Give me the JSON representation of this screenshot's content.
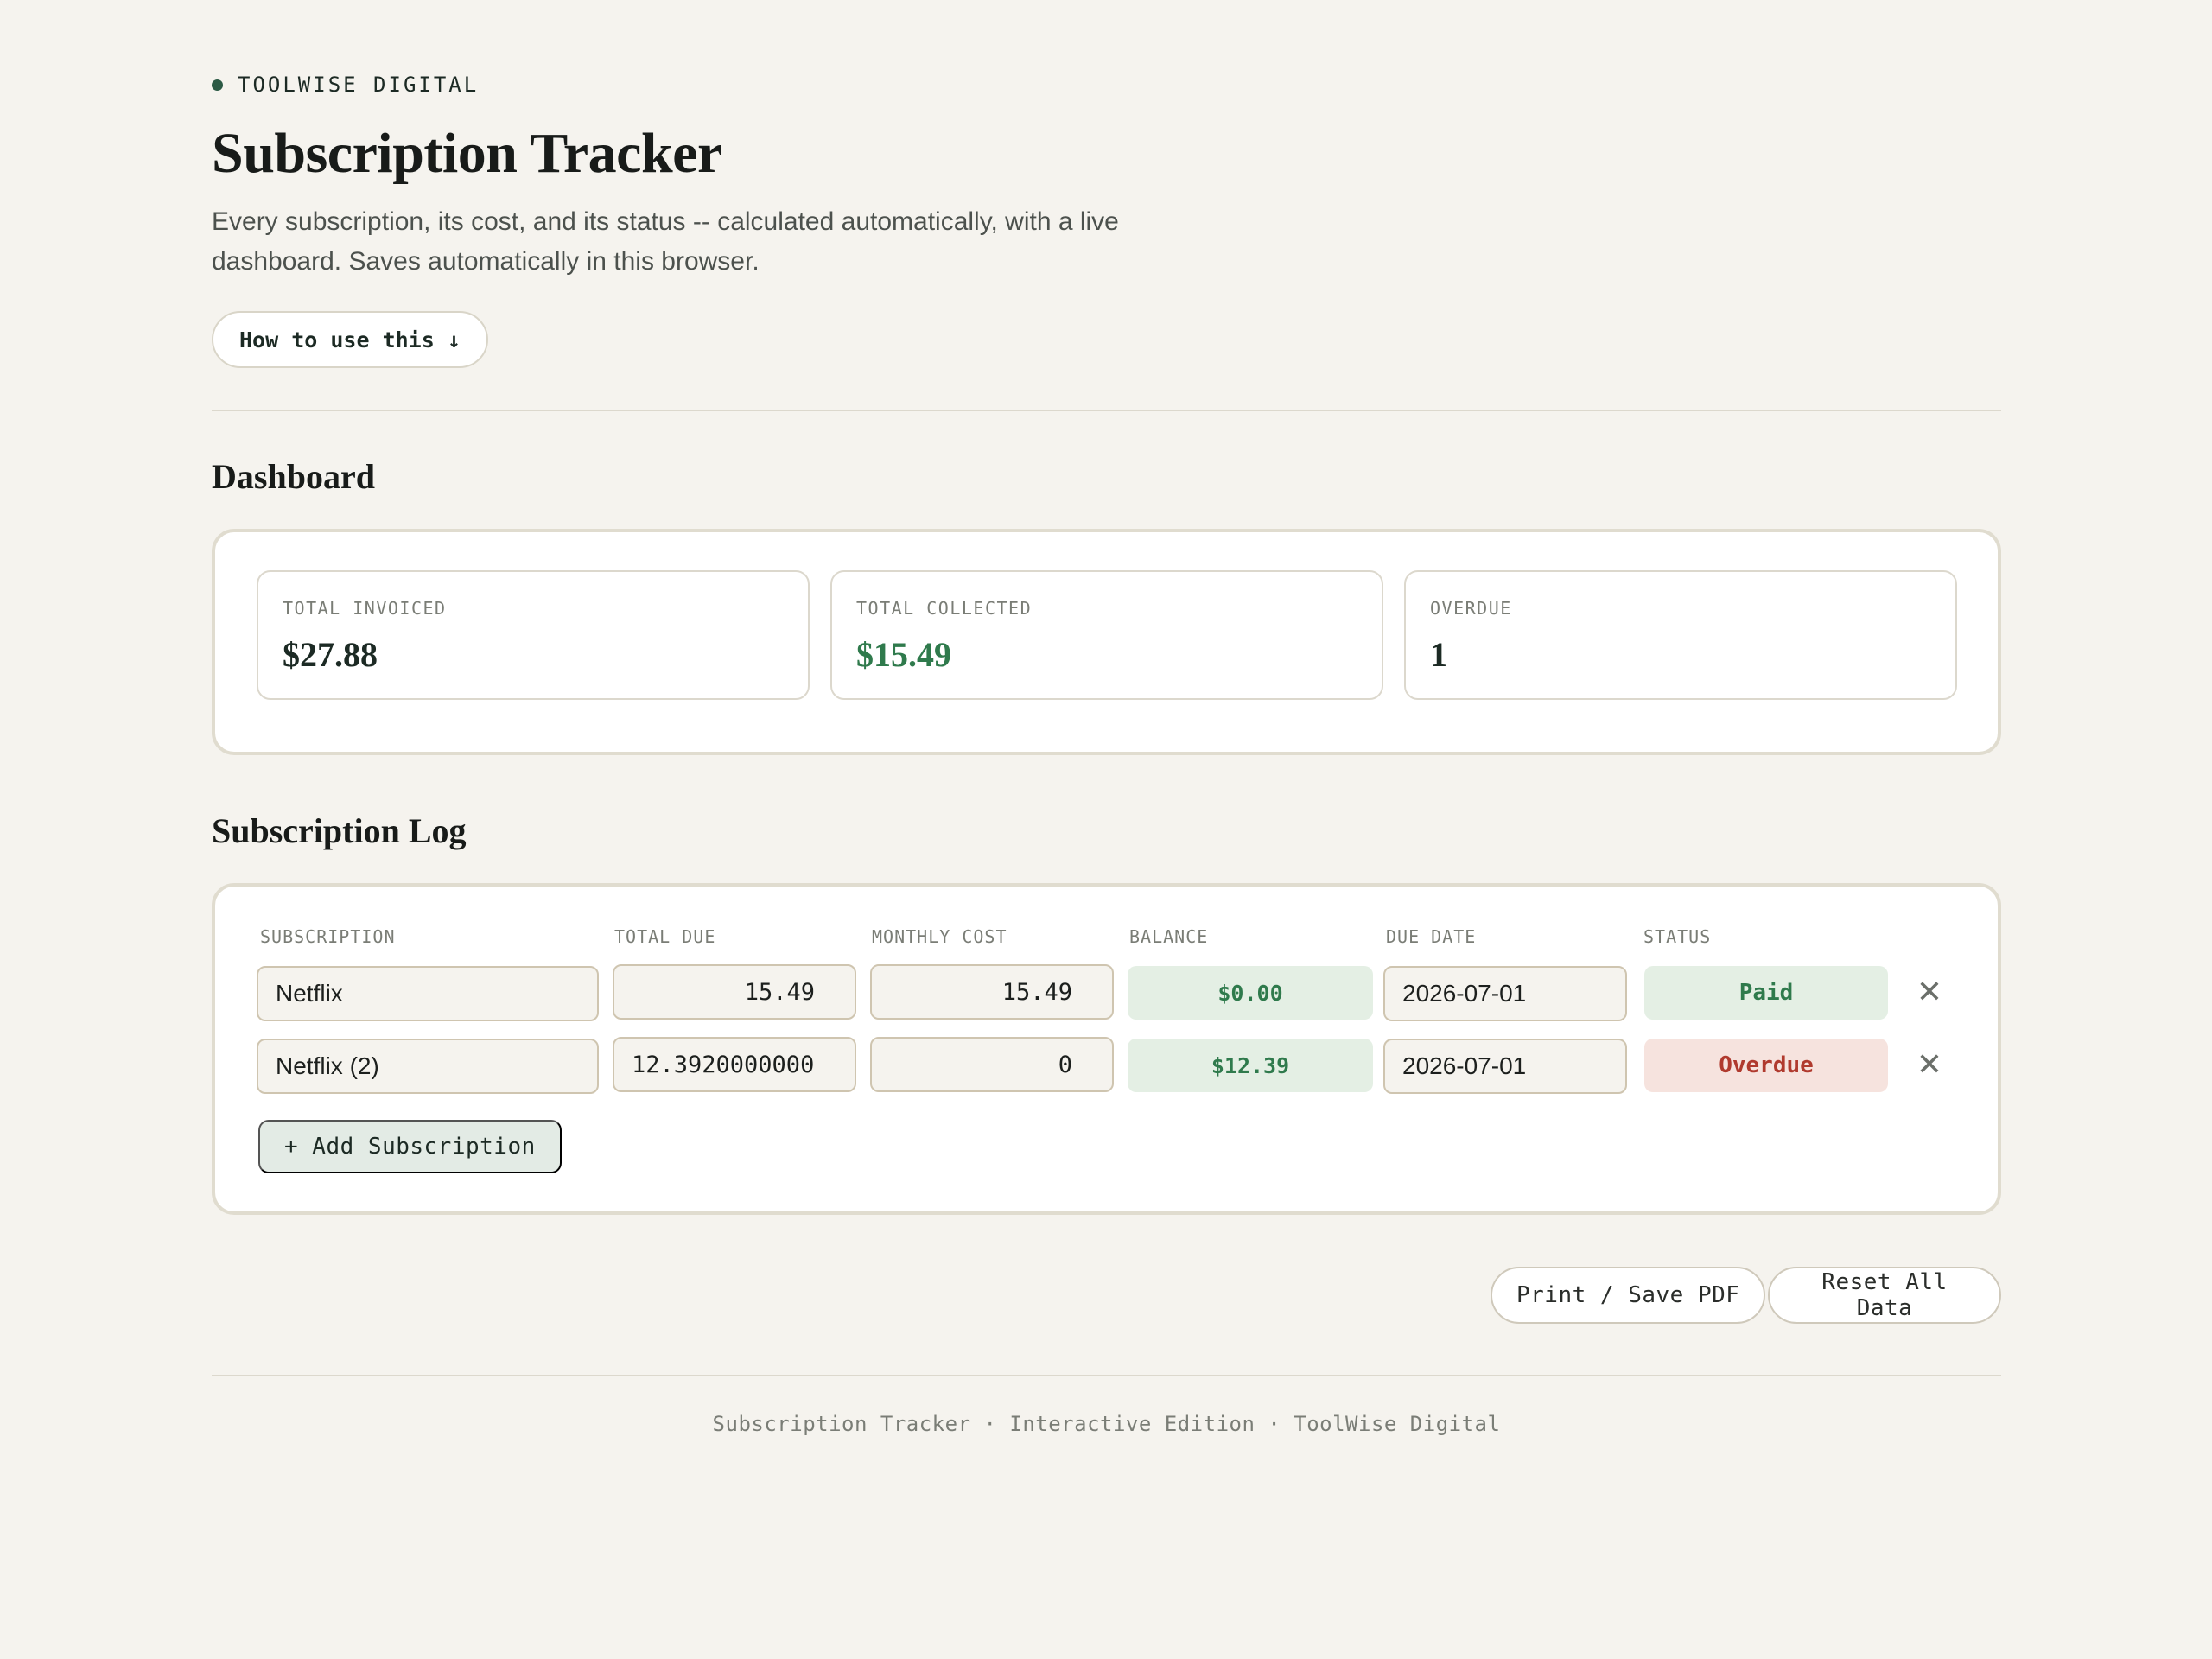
{
  "brand": {
    "name": "TOOLWISE DIGITAL"
  },
  "header": {
    "title": "Subscription Tracker",
    "description": "Every subscription, its cost, and its status -- calculated automatically, with a live dashboard. Saves automatically in this browser.",
    "howto_label": "How to use this ↓"
  },
  "dashboard": {
    "heading": "Dashboard",
    "stats": [
      {
        "label": "TOTAL INVOICED",
        "value": "$27.88"
      },
      {
        "label": "TOTAL COLLECTED",
        "value": "$15.49"
      },
      {
        "label": "OVERDUE",
        "value": "1"
      }
    ]
  },
  "log": {
    "heading": "Subscription Log",
    "columns": [
      "SUBSCRIPTION",
      "TOTAL DUE",
      "MONTHLY COST",
      "BALANCE",
      "DUE DATE",
      "STATUS"
    ],
    "rows": [
      {
        "subscription": "Netflix",
        "total_due": "15.49",
        "monthly_cost": "15.49",
        "balance": "$0.00",
        "due_date": "2026-07-01",
        "status": "Paid"
      },
      {
        "subscription": "Netflix (2)",
        "total_due": "12.3920000000",
        "monthly_cost": "0",
        "balance": "$12.39",
        "due_date": "2026-07-01",
        "status": "Overdue"
      }
    ],
    "delete_glyph": "✕",
    "add_label": "+ Add Subscription"
  },
  "actions": {
    "print_label": "Print / Save PDF",
    "reset_label": "Reset All Data"
  },
  "footer": {
    "text": "Subscription Tracker · Interactive Edition · ToolWise Digital"
  },
  "colors": {
    "background": "#f5f3ee",
    "accent_green": "#2f7a4c",
    "overdue_red": "#b03a2e"
  }
}
